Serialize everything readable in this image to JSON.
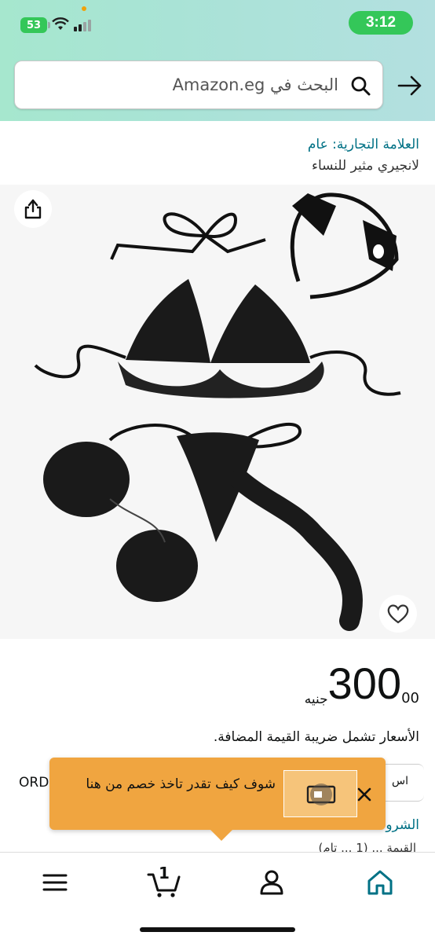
{
  "status": {
    "battery": "53",
    "time": "3:12"
  },
  "search": {
    "placeholder": "البحث في Amazon.eg"
  },
  "brand": {
    "link": "العلامة التجارية: عام"
  },
  "product": {
    "title": "لانجيري مثير للنساء"
  },
  "price": {
    "whole": "300",
    "fraction": "00",
    "currency": "جنيه"
  },
  "vat_note": "الأسعار تشمل ضريبة القيمة المضافة.",
  "partial": {
    "ord": "ORD",
    "box_text": "اس",
    "link": "الشرو",
    "qty": "القيمة ... (1 ... تام)"
  },
  "tooltip": {
    "text": "شوف كيف تقدر تاخذ خصم من هنا"
  },
  "nav": {
    "cart_count": "1"
  },
  "colors": {
    "accent_link": "#007185",
    "tooltip_bg": "#f0a540",
    "battery": "#34c759"
  }
}
